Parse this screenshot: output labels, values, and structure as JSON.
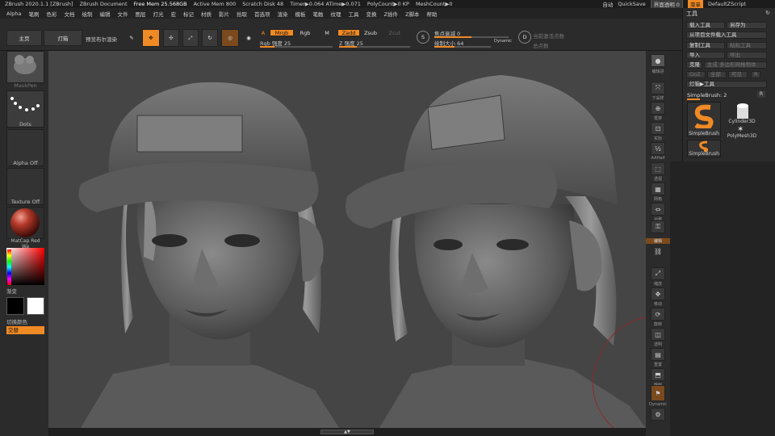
{
  "titlebar": {
    "app": "ZBrush 2020.1.1 [ZBrush]",
    "doc": "ZBrush Document",
    "free_mem": "Free Mem 25.568GB",
    "active_mem": "Active Mem 800",
    "scratch": "Scratch Disk 48",
    "timer": "Timer▶0.064 ATime▶0.071",
    "polycount": "PolyCount▶0 KP",
    "meshcount": "MeshCount▶0"
  },
  "quick": {
    "auto": "自动",
    "quicksave": "QuickSave",
    "transparency": "界面透明 0",
    "menu": "菜单",
    "script": "DefaultZScript"
  },
  "menubar": [
    "Alpha",
    "笔刷",
    "色彩",
    "文档",
    "绘制",
    "编辑",
    "文件",
    "图层",
    "灯光",
    "宏",
    "标记",
    "材质",
    "影片",
    "拾取",
    "首选项",
    "渲染",
    "模板",
    "笔触",
    "纹理",
    "工具",
    "变换",
    "Z插件",
    "Z脚本",
    "帮助"
  ],
  "toolbar": {
    "home": "主页",
    "lightbox": "灯箱",
    "preview": "预览布尔渲染",
    "edit_label": "编辑",
    "a": "A",
    "mrgb": "Mrgb",
    "rgb": "Rgb",
    "m": "M",
    "rgb_intensity": "Rgb 强度 25",
    "zadd": "Zadd",
    "zsub": "Zsub",
    "zcut": "Zcut",
    "z_intensity": "Z 强度 25",
    "focal": "焦点衰减 0",
    "draw_size": "绘制大小 64",
    "dynamic": "Dynamic",
    "active_points": "当前激活点数",
    "total_points": "总点数",
    "rgb_pct": 0.2,
    "z_pct": 0.25,
    "focal_pct": 0.5,
    "size_pct": 0.35
  },
  "left": {
    "brush": "MaskPen",
    "stroke": "Dots",
    "alpha": "Alpha Off",
    "texture": "Texture Off",
    "material": "MatCap Red Wa",
    "gradient": "渐变",
    "switch": "切换颜色",
    "alternate": "交替"
  },
  "right_strip": [
    "编辑进",
    "下采样",
    "框架",
    "实际",
    "AAHalf",
    "透视",
    "网格",
    "对称",
    "编辑",
    "链接",
    "缩放",
    "移动",
    "旋转",
    "透明",
    "重置",
    "映射",
    "Dynamic"
  ],
  "tool": {
    "title": "工具",
    "load": "载入工具",
    "save_as": "另存为",
    "load_project": "从项目文件载入工具",
    "copy": "复制工具",
    "paste": "粘贴工具",
    "import": "导入",
    "export": "导出",
    "clone": "克隆",
    "multi": "生成 多边形网格物体",
    "goz": "GoZ",
    "all": "全部",
    "visible": "可见",
    "r": "R",
    "lightbox_tools": "灯箱▶工具",
    "current": "SimpleBrush: 2",
    "items": [
      "SimpleBrush",
      "Cylinder3D",
      "PolyMesh3D",
      "SimpleBrush"
    ]
  }
}
